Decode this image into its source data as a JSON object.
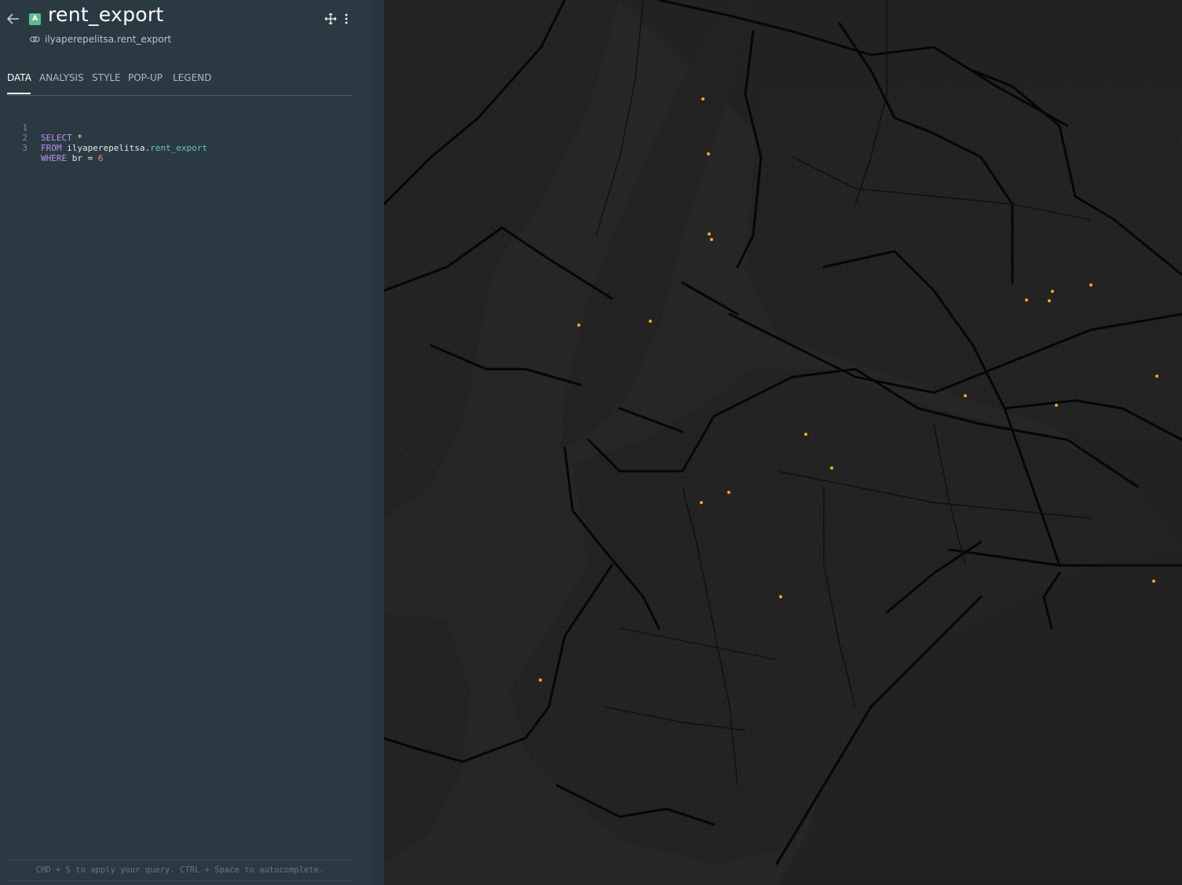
{
  "layer": {
    "badge": "A",
    "title": "rent_export",
    "source": "ilyaperepelitsa.rent_export"
  },
  "tabs": [
    "DATA",
    "ANALYSIS",
    "STYLE",
    "POP-UP",
    "LEGEND"
  ],
  "active_tab": "DATA",
  "query": {
    "line_numbers": [
      "1",
      "2",
      "3"
    ],
    "line1": {
      "kw": "SELECT",
      "rest": " *"
    },
    "line2": {
      "kw": "FROM",
      "schema": " ilyaperepelitsa.",
      "table": "rent_export"
    },
    "line3": {
      "kw": "WHERE",
      "rest": " br = ",
      "num": "6"
    }
  },
  "hint": "CMD + S to apply your query. CTRL + Space to autocomplete.",
  "map": {
    "basemap": "dark-matter",
    "colors": {
      "land": "#222222",
      "water": "#2a2a2a",
      "road": "#060606",
      "street": "#2e2e2e",
      "point": "#f5a623"
    },
    "point_count": 22
  }
}
